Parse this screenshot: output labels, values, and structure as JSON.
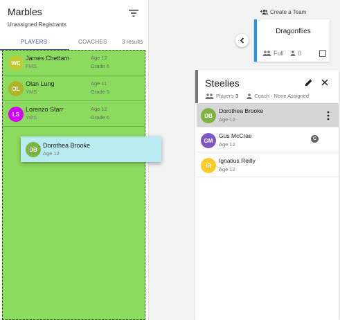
{
  "left_panel": {
    "title": "Marbles",
    "subtitle": "Unassigned Registrants",
    "tabs": [
      {
        "label": "PLAYERS",
        "active": true
      },
      {
        "label": "COACHES",
        "active": false
      }
    ],
    "results": "3 results",
    "registrants": [
      {
        "initials": "WC",
        "name": "James Chettam",
        "school": "FMS",
        "age": "Age 12",
        "grade": "Grade 6",
        "avatar_color": "#c0ca33"
      },
      {
        "initials": "OL",
        "name": "Olan Lung",
        "school": "YMS",
        "age": "Age 11",
        "grade": "Grade 5",
        "avatar_color": "#afb42b"
      },
      {
        "initials": "LS",
        "name": "Lorenzo Starr",
        "school": "YMS",
        "age": "Age 12",
        "grade": "Grade 6",
        "avatar_color": "#d500f9"
      }
    ],
    "dragging": {
      "initials": "DB",
      "name": "Dorothea Brooke",
      "age": "Age 12",
      "avatar_color": "#7cb342"
    },
    "drop_zone_color": "#8bdc5e"
  },
  "header": {
    "create_team": "Create a Team"
  },
  "team_card": {
    "name": "Dragonflies",
    "status": "Full",
    "count": "0",
    "accent": "#2196f3"
  },
  "team_panel": {
    "name": "Steelies",
    "players_label": "Players",
    "players_count": "3",
    "coach_label": "Coach - None Assigned",
    "members": [
      {
        "initials": "DB",
        "name": "Dorothea Brooke",
        "age": "Age 12",
        "avatar_color": "#7cb342",
        "selected": true
      },
      {
        "initials": "GM",
        "name": "Gus McCrae",
        "age": "Age 12",
        "avatar_color": "#7e57c2",
        "captain": "C"
      },
      {
        "initials": "IR",
        "name": "Ignatius Reilly",
        "age": "Age 12",
        "avatar_color": "#ffca28"
      }
    ]
  }
}
